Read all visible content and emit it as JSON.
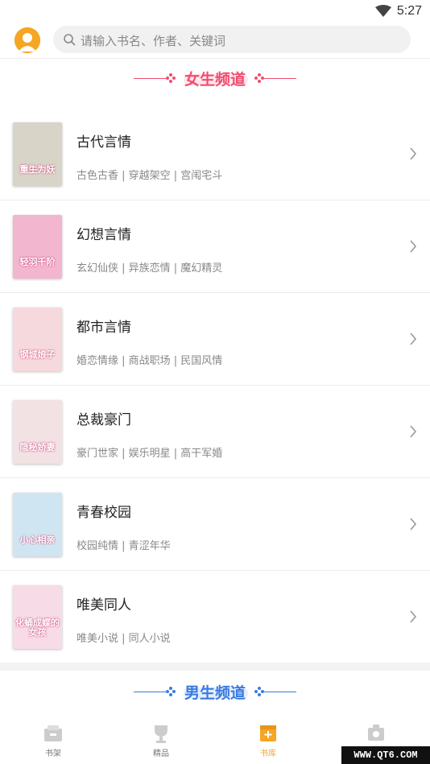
{
  "status_bar": {
    "time": "5:27"
  },
  "search": {
    "placeholder": "请输入书名、作者、关键词"
  },
  "female_channel": {
    "title": "女生频道",
    "color": "#f04e6e"
  },
  "male_channel": {
    "title": "男生频道",
    "color": "#3a7be0"
  },
  "categories": [
    {
      "title": "古代言情",
      "tags": "古色古香 | 穿越架空 | 宫闱宅斗",
      "cover_text": "重生为妖",
      "cover_color": "#d9d4c8"
    },
    {
      "title": "幻想言情",
      "tags": "玄幻仙侠 | 异族恋情 | 魔幻精灵",
      "cover_text": "轻羽千阶",
      "cover_color": "#f3b6cf"
    },
    {
      "title": "都市言情",
      "tags": "婚恋情缘 | 商战职场 | 民国风情",
      "cover_text": "钢城娘子",
      "cover_color": "#f6d9dd"
    },
    {
      "title": "总裁豪门",
      "tags": "豪门世家 | 娱乐明星 | 高干军婚",
      "cover_text": "隐秘娇妻",
      "cover_color": "#f2e2e4"
    },
    {
      "title": "青春校园",
      "tags": "校园纯情 | 青涩年华",
      "cover_text": "小心相亲",
      "cover_color": "#cfe6f2"
    },
    {
      "title": "唯美同人",
      "tags": "唯美小说 | 同人小说",
      "cover_text": "化蛹成蝶的女孩",
      "cover_color": "#f7dbe6"
    }
  ],
  "tabbar": {
    "tabs": [
      {
        "label": "书架",
        "icon": "bookshelf-icon"
      },
      {
        "label": "精品",
        "icon": "trophy-icon"
      },
      {
        "label": "书库",
        "icon": "library-icon",
        "active": true
      },
      {
        "label": "",
        "icon": "profile-icon"
      }
    ],
    "active_color": "#f5a623"
  },
  "watermark": "WWW.QT6.COM"
}
